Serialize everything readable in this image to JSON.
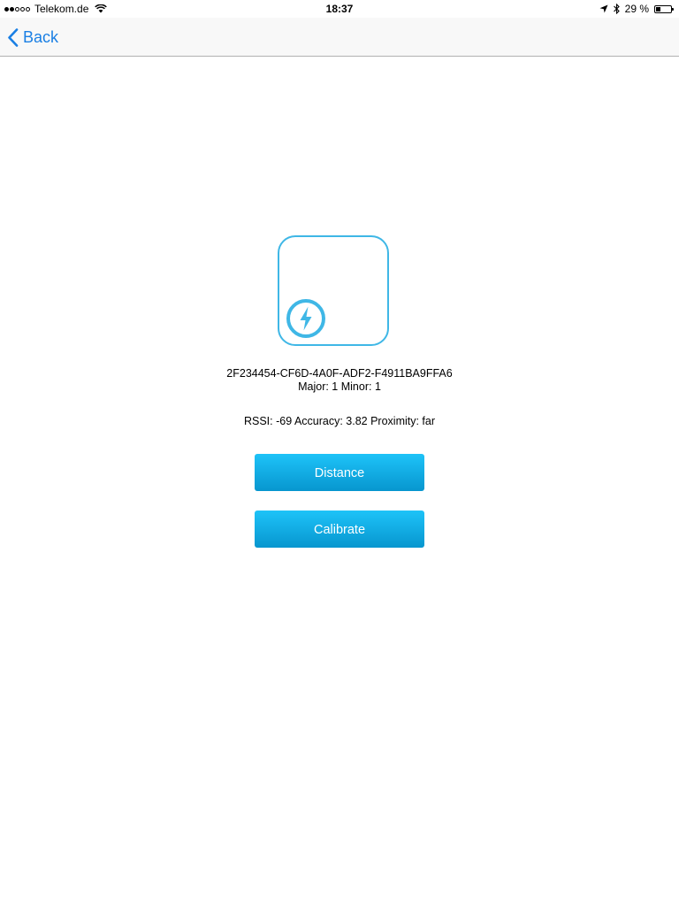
{
  "status_bar": {
    "carrier": "Telekom.de",
    "time": "18:37",
    "battery_percent": "29 %",
    "battery_level": 0.29,
    "signal_bars_filled": 2,
    "signal_bars_total": 5
  },
  "nav": {
    "back_label": "Back",
    "accent_color": "#1a7fe4"
  },
  "beacon": {
    "uuid": "2F234454-CF6D-4A0F-ADF2-F4911BA9FFA6",
    "major_minor": "Major: 1 Minor: 1",
    "signal_info": "RSSI: -69 Accuracy: 3.82 Proximity: far",
    "icon": "bolt-icon",
    "color": "#3fb7e6"
  },
  "buttons": {
    "distance_label": "Distance",
    "calibrate_label": "Calibrate",
    "color": "#1ec3f8"
  }
}
